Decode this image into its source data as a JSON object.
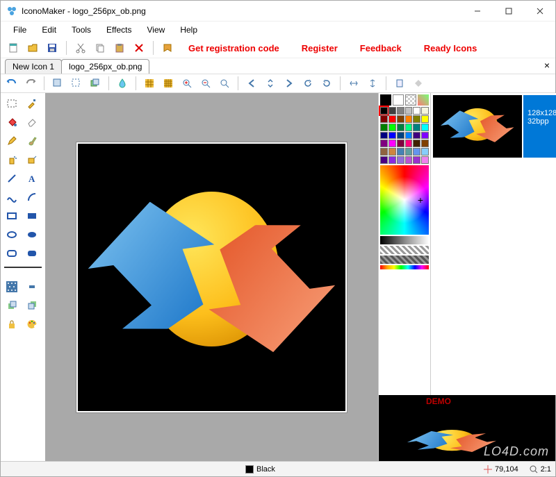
{
  "app": {
    "title": "IconoMaker - logo_256px_ob.png"
  },
  "menu": {
    "items": [
      "File",
      "Edit",
      "Tools",
      "Effects",
      "View",
      "Help"
    ]
  },
  "redlinks": {
    "get_code": "Get registration code",
    "register": "Register",
    "feedback": "Feedback",
    "ready_icons": "Ready Icons"
  },
  "tabs": {
    "items": [
      {
        "label": "New Icon 1",
        "active": false
      },
      {
        "label": "logo_256px_ob.png",
        "active": true
      }
    ]
  },
  "palette": {
    "current_fg": "#000000",
    "current_bg": "#ffffff",
    "swatches": [
      "#000000",
      "#404040",
      "#808080",
      "#c0c0c0",
      "#ffffff",
      "#f5f5dc",
      "#800000",
      "#ff0000",
      "#804000",
      "#ff8000",
      "#808000",
      "#ffff00",
      "#008000",
      "#00ff00",
      "#008040",
      "#00ff80",
      "#008080",
      "#00ffff",
      "#000080",
      "#0000ff",
      "#004080",
      "#0080ff",
      "#400080",
      "#8000ff",
      "#800080",
      "#ff00ff",
      "#800040",
      "#ff0080",
      "#402000",
      "#804000",
      "#8f6340",
      "#cd853f",
      "#4682b4",
      "#5f9ea0",
      "#6495ed",
      "#87cefa",
      "#4b0082",
      "#8a2be2",
      "#9370db",
      "#ba55d3",
      "#9932cc",
      "#ee82ee"
    ]
  },
  "preview": {
    "size_label": "128x128",
    "bpp_label": "32bpp",
    "demo_watermark": "DEMO"
  },
  "status": {
    "color_name": "Black",
    "coords": "79,104",
    "zoom": "2:1"
  },
  "watermark": "LO4D.com"
}
